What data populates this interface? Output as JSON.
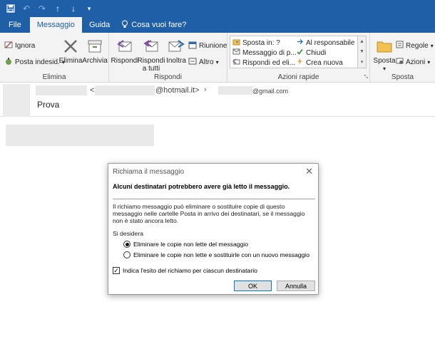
{
  "tabs": {
    "file": "File",
    "message": "Messaggio",
    "help": "Guida",
    "tell_me": "Cosa vuoi fare?"
  },
  "ribbon": {
    "delete_group": {
      "label": "Elimina",
      "ignore": "Ignora",
      "junk": "Posta indesid.",
      "delete": "Elimina",
      "archive": "Archivia"
    },
    "respond_group": {
      "label": "Rispondi",
      "reply": "Rispondi",
      "reply_all_line1": "Rispondi",
      "reply_all_line2": "a tutti",
      "forward": "Inoltra",
      "meeting": "Riunione",
      "more": "Altro"
    },
    "quick_steps": {
      "label": "Azioni rapide",
      "items": [
        "Sposta in: ?",
        "Messaggio di p...",
        "Rispondi ed eli...",
        "Al responsabile",
        "Chiudi",
        "Crea nuova"
      ]
    },
    "move_group": {
      "label": "Sposta",
      "move": "Sposta",
      "rules": "Regole",
      "actions": "Azioni"
    }
  },
  "message": {
    "from_suffix": "@hotmail.it>",
    "to_suffix": "@gmail.com",
    "subject": "Prova"
  },
  "dialog": {
    "title": "Richiama il messaggio",
    "warning": "Alcuni destinatari potrebbero avere già letto il messaggio.",
    "description": "Il richiamo messaggio può eliminare o sostituire copie di questo messaggio nelle cartelle Posta in arrivo dei destinatari, se il messaggio non è stato ancora letto.",
    "ask": "Si desidera",
    "option_delete": "Eliminare le copie non lette del messaggio",
    "option_replace": "Eliminare le copie non lette e sostituirle con un nuovo messaggio",
    "selected_option": "option_delete",
    "report_checkbox": "Indica l'esito del richiamo per ciascun destinatario",
    "report_checked": true,
    "ok": "OK",
    "cancel": "Annulla"
  },
  "colors": {
    "accent": "#1f5fa8",
    "ribbon_bg": "#f3f3f3"
  }
}
